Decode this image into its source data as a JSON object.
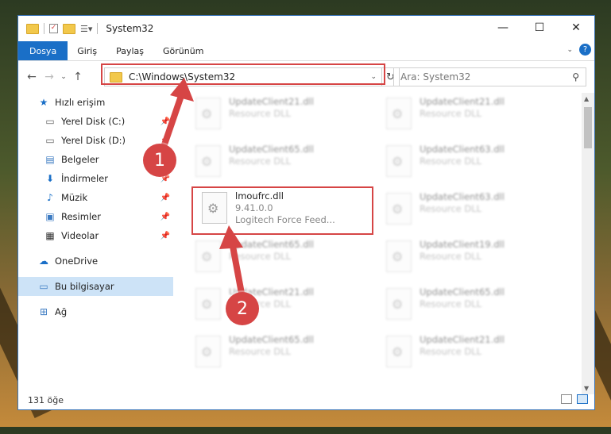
{
  "window": {
    "title": "System32",
    "controls": {
      "minimize": "—",
      "maximize": "☐",
      "close": "✕"
    }
  },
  "ribbon": {
    "tabs": [
      {
        "label": "Dosya",
        "active": true
      },
      {
        "label": "Giriş",
        "active": false
      },
      {
        "label": "Paylaş",
        "active": false
      },
      {
        "label": "Görünüm",
        "active": false
      }
    ],
    "help": "?"
  },
  "navigation": {
    "address": "C:\\Windows\\System32",
    "search_placeholder": "Ara: System32"
  },
  "sidebar": {
    "items": [
      {
        "label": "Hızlı erişim",
        "icon": "star-icon",
        "pinned": false
      },
      {
        "label": "Yerel Disk (C:)",
        "icon": "drive-icon",
        "pinned": true
      },
      {
        "label": "Yerel Disk (D:)",
        "icon": "drive-icon",
        "pinned": true
      },
      {
        "label": "Belgeler",
        "icon": "documents-icon",
        "pinned": true
      },
      {
        "label": "İndirmeler",
        "icon": "download-icon",
        "pinned": true
      },
      {
        "label": "Müzik",
        "icon": "music-icon",
        "pinned": true
      },
      {
        "label": "Resimler",
        "icon": "pictures-icon",
        "pinned": true
      },
      {
        "label": "Videolar",
        "icon": "video-icon",
        "pinned": true
      },
      {
        "label": "OneDrive",
        "icon": "cloud-icon",
        "pinned": false
      },
      {
        "label": "Bu bilgisayar",
        "icon": "computer-icon",
        "pinned": false,
        "selected": true
      },
      {
        "label": "Ağ",
        "icon": "network-icon",
        "pinned": false
      }
    ]
  },
  "files": {
    "highlighted": {
      "name": "lmoufrc.dll",
      "version": "9.41.0.0",
      "description": "Logitech Force Feed..."
    },
    "blurred": [
      {
        "name": "UpdateClient21.dll",
        "type": "Resource DLL"
      },
      {
        "name": "UpdateClient21.dll",
        "type": "Resource DLL"
      },
      {
        "name": "UpdateClient65.dll",
        "type": "Resource DLL"
      },
      {
        "name": "UpdateClient63.dll",
        "type": "Resource DLL"
      },
      {
        "name": "UpdateClient63.dll",
        "type": "Resource DLL"
      },
      {
        "name": "UpdateClient65.dll",
        "type": "Resource DLL"
      },
      {
        "name": "UpdateClient19.dll",
        "type": "Resource DLL"
      },
      {
        "name": "UpdateClient21.dll",
        "type": "Resource DLL"
      },
      {
        "name": "UpdateClient65.dll",
        "type": "Resource DLL"
      },
      {
        "name": "UpdateClient65.dll",
        "type": "Resource DLL"
      },
      {
        "name": "UpdateClient21.dll",
        "type": "Resource DLL"
      }
    ]
  },
  "status": {
    "count": "131 öğe"
  },
  "annotations": {
    "marker1": "1",
    "marker2": "2",
    "color": "#d64545"
  }
}
